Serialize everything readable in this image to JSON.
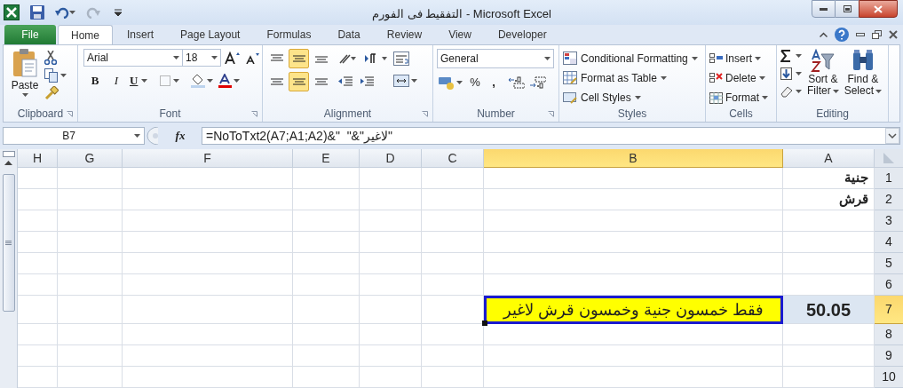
{
  "window": {
    "title": "التفقيط فى الفورم - Microsoft Excel"
  },
  "ribbon_tabs": [
    {
      "label": "File",
      "kind": "file",
      "selected": false
    },
    {
      "label": "Home",
      "kind": "tab",
      "selected": true
    },
    {
      "label": "Insert",
      "kind": "tab",
      "selected": false
    },
    {
      "label": "Page Layout",
      "kind": "tab",
      "selected": false
    },
    {
      "label": "Formulas",
      "kind": "tab",
      "selected": false
    },
    {
      "label": "Data",
      "kind": "tab",
      "selected": false
    },
    {
      "label": "Review",
      "kind": "tab",
      "selected": false
    },
    {
      "label": "View",
      "kind": "tab",
      "selected": false
    },
    {
      "label": "Developer",
      "kind": "tab",
      "selected": false
    }
  ],
  "ribbon": {
    "clipboard": {
      "label": "Clipboard",
      "paste": "Paste"
    },
    "font": {
      "label": "Font",
      "font": "Arial",
      "size": "18",
      "bold": "B",
      "italic": "I",
      "underline": "U"
    },
    "alignment": {
      "label": "Alignment",
      "vertical": [
        {
          "selected": false
        },
        {
          "selected": true
        },
        {
          "selected": false
        }
      ],
      "horizontal": [
        {
          "selected": false
        },
        {
          "selected": true
        },
        {
          "selected": false
        }
      ]
    },
    "number": {
      "label": "Number",
      "format": "General",
      "percent": "%",
      "comma": ","
    },
    "styles": {
      "label": "Styles",
      "items": [
        "Conditional Formatting",
        "Format as Table",
        "Cell Styles"
      ]
    },
    "cells": {
      "label": "Cells",
      "items": [
        "Insert",
        "Delete",
        "Format"
      ]
    },
    "editing": {
      "label": "Editing",
      "buttons": [
        [
          "Sort &",
          "Filter"
        ],
        [
          "Find &",
          "Select"
        ]
      ]
    }
  },
  "formula_bar": {
    "name_box": "B7",
    "fx": "fx",
    "formula": "=NoToTxt2(A7;A1;A2)&\"  \"&\"لاغير\""
  },
  "columns": [
    {
      "label": "H",
      "selected": false
    },
    {
      "label": "G",
      "selected": false
    },
    {
      "label": "F",
      "selected": false
    },
    {
      "label": "E",
      "selected": false
    },
    {
      "label": "D",
      "selected": false
    },
    {
      "label": "C",
      "selected": false
    },
    {
      "label": "B",
      "selected": true
    },
    {
      "label": "A",
      "selected": false
    }
  ],
  "rows": [
    {
      "label": "1",
      "selected": false,
      "A": {
        "text": "جنية",
        "active": false
      }
    },
    {
      "label": "2",
      "selected": false,
      "A": {
        "text": "قرش",
        "active": false
      }
    },
    {
      "label": "3",
      "selected": false
    },
    {
      "label": "4",
      "selected": false
    },
    {
      "label": "5",
      "selected": false
    },
    {
      "label": "6",
      "selected": false
    },
    {
      "label": "7",
      "selected": true,
      "A": {
        "text": "50.05",
        "active": false
      },
      "B": {
        "text": "فقط خمسون جنية وخمسون قرش  لاغير",
        "active": true,
        "color": "#ffff00"
      }
    },
    {
      "label": "8",
      "selected": false
    },
    {
      "label": "9",
      "selected": false
    },
    {
      "label": "10",
      "selected": false
    }
  ]
}
